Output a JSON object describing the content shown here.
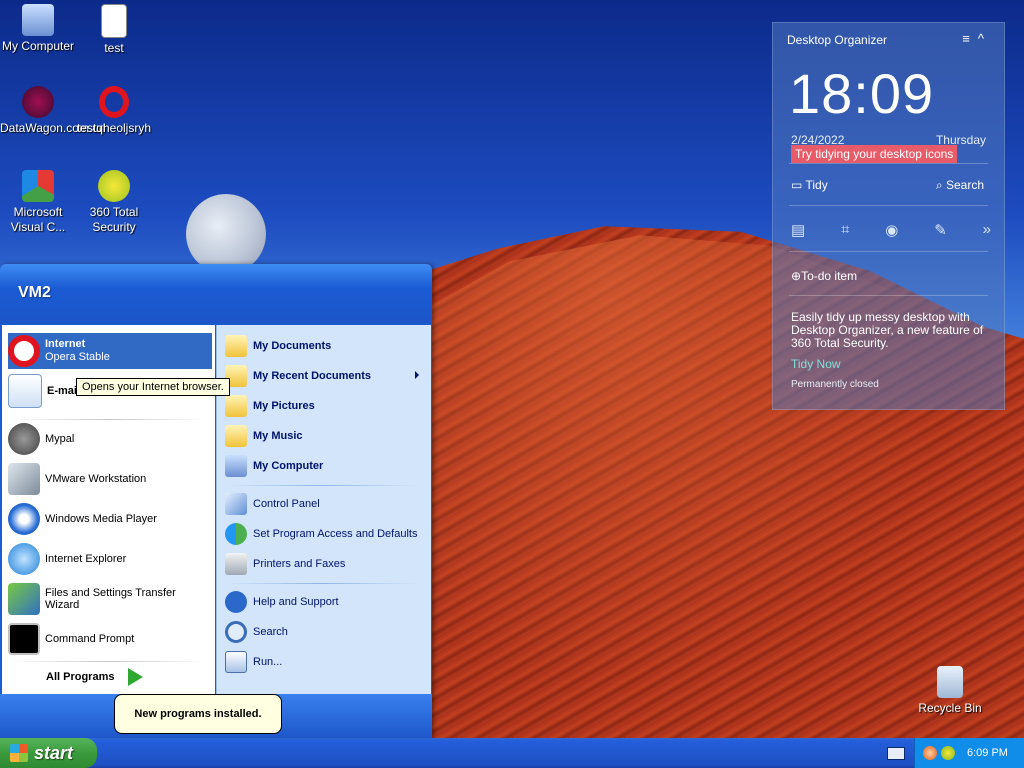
{
  "desktop": {
    "icons": [
      {
        "label": "My Computer",
        "icon": "computer-icon"
      },
      {
        "label": "test",
        "icon": "text-file-icon"
      },
      {
        "label": "DataWagon.com.url",
        "icon": "url-shortcut-icon"
      },
      {
        "label": "testqheoljsryh",
        "icon": "opera-icon"
      },
      {
        "label": "Microsoft Visual C...",
        "icon": "visual-studio-icon"
      },
      {
        "label": "360 Total Security",
        "icon": "360-security-icon"
      },
      {
        "label": "Recycle Bin",
        "icon": "recycle-bin-icon"
      }
    ]
  },
  "organizer": {
    "title": "Desktop Organizer",
    "time": "18:09",
    "date": "2/24/2022",
    "weekday": "Thursday",
    "tip": "Try tidying your desktop icons",
    "tidy": "Tidy",
    "search": "Search",
    "todo": "To-do item",
    "description": "Easily tidy up messy desktop with Desktop Organizer, a new feature of 360 Total Security.",
    "tidy_now": "Tidy Now",
    "permanently_closed": "Permanently closed"
  },
  "start_menu": {
    "user": "VM2",
    "pinned": [
      {
        "title": "Internet",
        "subtitle": "Opera Stable",
        "icon": "opera-icon"
      },
      {
        "title": "E-mail",
        "subtitle": "",
        "icon": "email-icon"
      }
    ],
    "recent": [
      {
        "label": "Mypal",
        "icon": "mypal-icon"
      },
      {
        "label": "VMware Workstation",
        "icon": "vmware-icon"
      },
      {
        "label": "Windows Media Player",
        "icon": "media-player-icon"
      },
      {
        "label": "Internet Explorer",
        "icon": "ie-icon"
      },
      {
        "label": "Files and Settings Transfer Wizard",
        "icon": "transfer-wizard-icon"
      },
      {
        "label": "Command Prompt",
        "icon": "cmd-icon"
      }
    ],
    "all_programs": "All Programs",
    "places": [
      {
        "label": "My Documents",
        "icon": "folder-documents-icon"
      },
      {
        "label": "My Recent Documents",
        "icon": "recent-documents-icon"
      },
      {
        "label": "My Pictures",
        "icon": "folder-pictures-icon"
      },
      {
        "label": "My Music",
        "icon": "folder-music-icon"
      },
      {
        "label": "My Computer",
        "icon": "computer-icon"
      }
    ],
    "system": [
      {
        "label": "Control Panel",
        "icon": "control-panel-icon"
      },
      {
        "label": "Set Program Access and Defaults",
        "icon": "program-defaults-icon"
      },
      {
        "label": "Printers and Faxes",
        "icon": "printer-icon"
      }
    ],
    "help": [
      {
        "label": "Help and Support",
        "icon": "help-icon"
      },
      {
        "label": "Search",
        "icon": "search-icon"
      },
      {
        "label": "Run...",
        "icon": "run-icon"
      }
    ],
    "tooltip": "Opens your Internet browser."
  },
  "balloon": "New programs installed.",
  "taskbar": {
    "start": "start",
    "clock": "6:09 PM"
  }
}
